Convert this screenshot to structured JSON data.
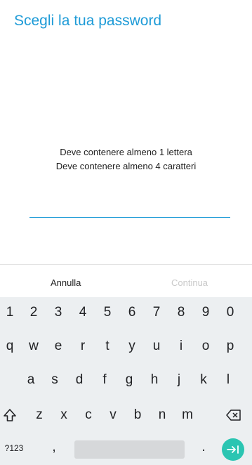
{
  "screen": {
    "title": "Scegli la tua password",
    "requirements": [
      "Deve contenere almeno 1 lettera",
      "Deve contenere almeno 4 caratteri"
    ],
    "password_value": ""
  },
  "actions": {
    "cancel_label": "Annulla",
    "continue_label": "Continua",
    "continue_enabled": false
  },
  "keyboard": {
    "rows": [
      [
        "1",
        "2",
        "3",
        "4",
        "5",
        "6",
        "7",
        "8",
        "9",
        "0"
      ],
      [
        "q",
        "w",
        "e",
        "r",
        "t",
        "y",
        "u",
        "i",
        "o",
        "p"
      ],
      [
        "a",
        "s",
        "d",
        "f",
        "g",
        "h",
        "j",
        "k",
        "l"
      ],
      [
        "z",
        "x",
        "c",
        "v",
        "b",
        "n",
        "m"
      ]
    ],
    "symbols_label": "?123",
    "comma_label": ",",
    "period_label": ".",
    "icons": {
      "shift": "shift-icon",
      "backspace": "backspace-icon",
      "enter": "next-icon"
    }
  },
  "colors": {
    "accent": "#1e9bd7",
    "enter_key": "#2bc5b2",
    "keyboard_bg": "#eceff1",
    "disabled_text": "#c9c9c9"
  }
}
